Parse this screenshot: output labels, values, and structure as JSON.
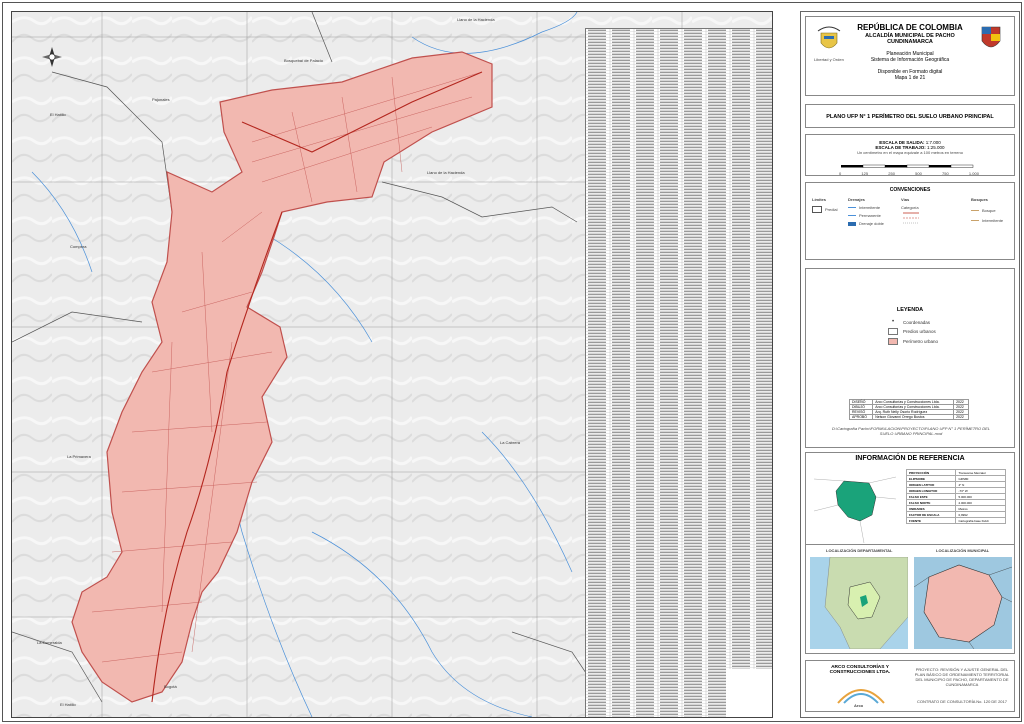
{
  "header": {
    "country": "REPÚBLICA DE COLOMBIA",
    "municipality": "ALCALDÍA MUNICIPAL DE PACHO",
    "department": "CUNDINAMARCA",
    "office": "Planeación Municipal",
    "system": "Sistema de Información Geográfica",
    "format": "Disponible en Formato digital",
    "map_number": "Mapa 1 de 21",
    "coat_caption": "Libertad y Orden"
  },
  "plan_title": "PLANO UFP N° 1  PERÍMETRO DEL SUELO URBANO PRINCIPAL",
  "scale": {
    "output_label": "ESCALA DE SALIDA:",
    "output_value": "1:7.000",
    "work_label": "ESCALA DE TRABAJO:",
    "work_value": "1:25.000",
    "note": "Un centímetro en el mapa equivale a 100 metros en terreno",
    "bar_ticks": [
      "0",
      "125",
      "250",
      "500",
      "750",
      "1.000"
    ]
  },
  "conventions": {
    "title": "CONVENCIONES",
    "groups": [
      {
        "title": "Límites",
        "items": [
          "Predial"
        ]
      },
      {
        "title": "Drenajes",
        "items": [
          "Intermitente",
          "Permanente",
          "Drenaje doble"
        ]
      },
      {
        "title": "Vías",
        "items": [
          "Categoría"
        ]
      },
      {
        "title": "Bosques",
        "items": [
          "Bosque",
          "Intermitente"
        ]
      }
    ]
  },
  "legend": {
    "title": "LEYENDA",
    "items": [
      {
        "label": "Coordenadas",
        "color": "#ffffff"
      },
      {
        "label": "Predios urbanos",
        "color": "#ffffff"
      },
      {
        "label": "Perímetro urbano",
        "color": "#f2b8b0"
      }
    ]
  },
  "credits": [
    {
      "role": "DISEÑÓ",
      "name": "Arco Consultorías y Construcciones Ltda.",
      "year": "2022"
    },
    {
      "role": "DIBUJÓ",
      "name": "Arco Consultorías y Construcciones Ltda.",
      "year": "2022"
    },
    {
      "role": "REVISÓ",
      "name": "Arq. Ruth Nelly Osorio Rodríguez",
      "year": "2022"
    },
    {
      "role": "APROBÓ",
      "name": "Nelson Giovanni Orrego Bustos",
      "year": "2022"
    }
  ],
  "file_path": "D:\\Cartografía Pacho\\FORMULACION\\PROYECTO\\PLANO UFP N° 1 PERÍMETRO DEL SUELO URBANO PRINCIPAL.mxd",
  "reference": {
    "title": "INFORMACIÓN DE REFERENCIA",
    "rows": [
      {
        "k": "PROYECCIÓN",
        "v": "Transverse Mercator"
      },
      {
        "k": "ELIPSOIDE",
        "v": "GRS80"
      },
      {
        "k": "ORIGEN LATITUD",
        "v": "4° N"
      },
      {
        "k": "ORIGEN LONGITUD",
        "v": "-73° W"
      },
      {
        "k": "FALSO ESTE",
        "v": "5.000.000"
      },
      {
        "k": "FALSO NORTE",
        "v": "2.000.000"
      },
      {
        "k": "UNIDADES",
        "v": "Metros"
      },
      {
        "k": "FACTOR DE ESCALA",
        "v": "0,9992"
      },
      {
        "k": "FUENTE",
        "v": "Cartografía base IGAC"
      }
    ],
    "dept_label": "LOCALIZACIÓN DEPARTAMENTAL",
    "muni_label": "LOCALIZACIÓN MUNICIPAL"
  },
  "company": {
    "name": "ARCO CONSULTORÍAS Y CONSTRUCCIONES LTDA.",
    "logo_text": "Arco",
    "project": "PROYECTO: REVISIÓN Y AJUSTE GENERAL DEL PLAN BÁSICO DE ORDENAMIENTO TERRITORIAL DEL MUNICIPIO DE PACHO, DEPARTAMENTO DE CUNDINAMARCA",
    "contract": "CONTRATO DE CONSULTORÍA No. 120 DE 2017"
  },
  "map_places": [
    {
      "name": "Llano de la Hacienda"
    },
    {
      "name": "Bosquebaí de Palacio"
    },
    {
      "name": "Pajonales"
    },
    {
      "name": "El Hatillo"
    },
    {
      "name": "Llano de la Hacienda"
    },
    {
      "name": "Compera"
    },
    {
      "name": "La Primavera"
    },
    {
      "name": "La Cabrera"
    },
    {
      "name": "La Esmeralda"
    },
    {
      "name": "Bogotá"
    },
    {
      "name": "El Hatillo"
    }
  ],
  "colors": {
    "urban_fill": "#f2b8b0",
    "urban_stroke": "#c0504d",
    "road": "#c0392b",
    "river": "#4a90d9",
    "terrain": "#eeeeee",
    "dept_highlight": "#1aa37a"
  }
}
